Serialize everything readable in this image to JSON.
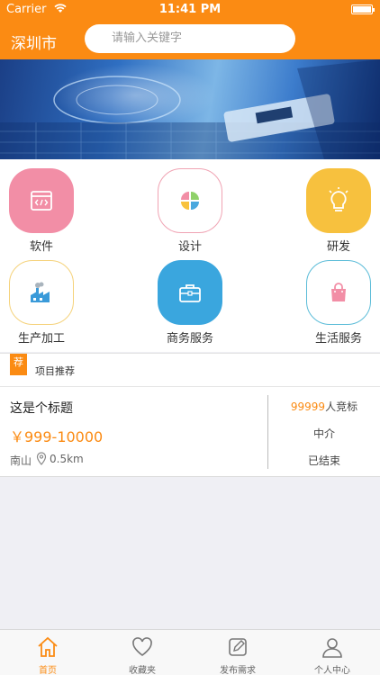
{
  "status_bar": {
    "carrier": "Carrier",
    "time": "11:41 PM"
  },
  "header": {
    "city": "深圳市",
    "search_placeholder": "请输入关键字"
  },
  "categories": [
    {
      "label": "软件",
      "icon": "code-window-icon"
    },
    {
      "label": "设计",
      "icon": "four-petal-icon"
    },
    {
      "label": "研发",
      "icon": "lightbulb-icon"
    },
    {
      "label": "生产加工",
      "icon": "factory-icon"
    },
    {
      "label": "商务服务",
      "icon": "briefcase-icon"
    },
    {
      "label": "生活服务",
      "icon": "shopping-bag-icon"
    }
  ],
  "section": {
    "tag": "荐",
    "title": "项目推荐"
  },
  "project": {
    "title": "这是个标题",
    "price": "￥999-10000",
    "location": "南山",
    "distance": "0.5km",
    "bid_count": "99999",
    "bid_suffix": "人竞标",
    "role": "中介",
    "status": "已结束"
  },
  "tabs": [
    {
      "label": "首页",
      "icon": "home-icon",
      "active": true
    },
    {
      "label": "收藏夹",
      "icon": "heart-icon",
      "active": false
    },
    {
      "label": "发布需求",
      "icon": "edit-icon",
      "active": false
    },
    {
      "label": "个人中心",
      "icon": "person-icon",
      "active": false
    }
  ],
  "colors": {
    "accent": "#fb8b13",
    "background": "#efeff4"
  }
}
